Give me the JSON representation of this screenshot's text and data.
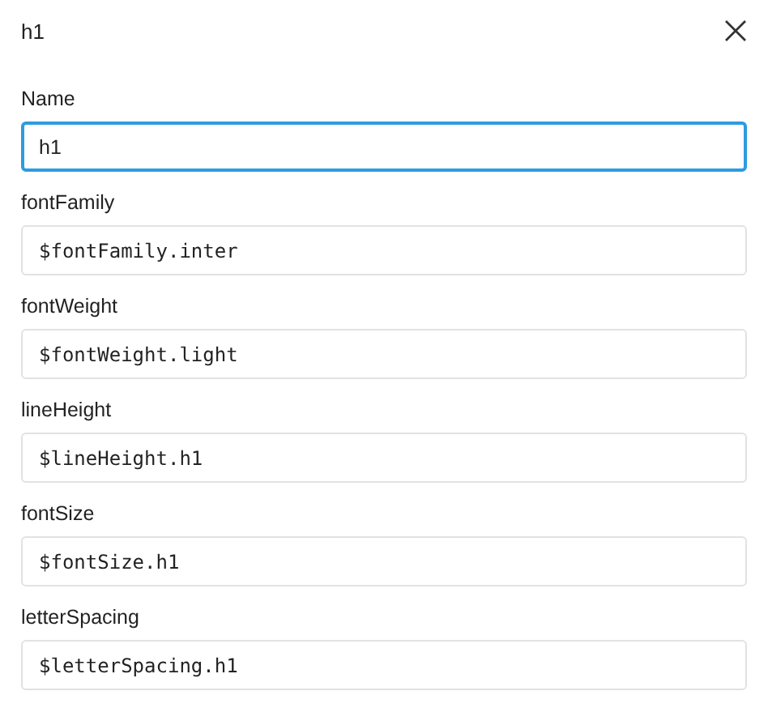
{
  "dialog": {
    "title": "h1"
  },
  "fields": [
    {
      "label": "Name",
      "value": "h1",
      "kind": "text",
      "focused": true
    },
    {
      "label": "fontFamily",
      "value": "$fontFamily.inter",
      "kind": "token",
      "focused": false
    },
    {
      "label": "fontWeight",
      "value": "$fontWeight.light",
      "kind": "token",
      "focused": false
    },
    {
      "label": "lineHeight",
      "value": "$lineHeight.h1",
      "kind": "token",
      "focused": false
    },
    {
      "label": "fontSize",
      "value": "$fontSize.h1",
      "kind": "token",
      "focused": false
    },
    {
      "label": "letterSpacing",
      "value": "$letterSpacing.h1",
      "kind": "token",
      "focused": false
    }
  ]
}
